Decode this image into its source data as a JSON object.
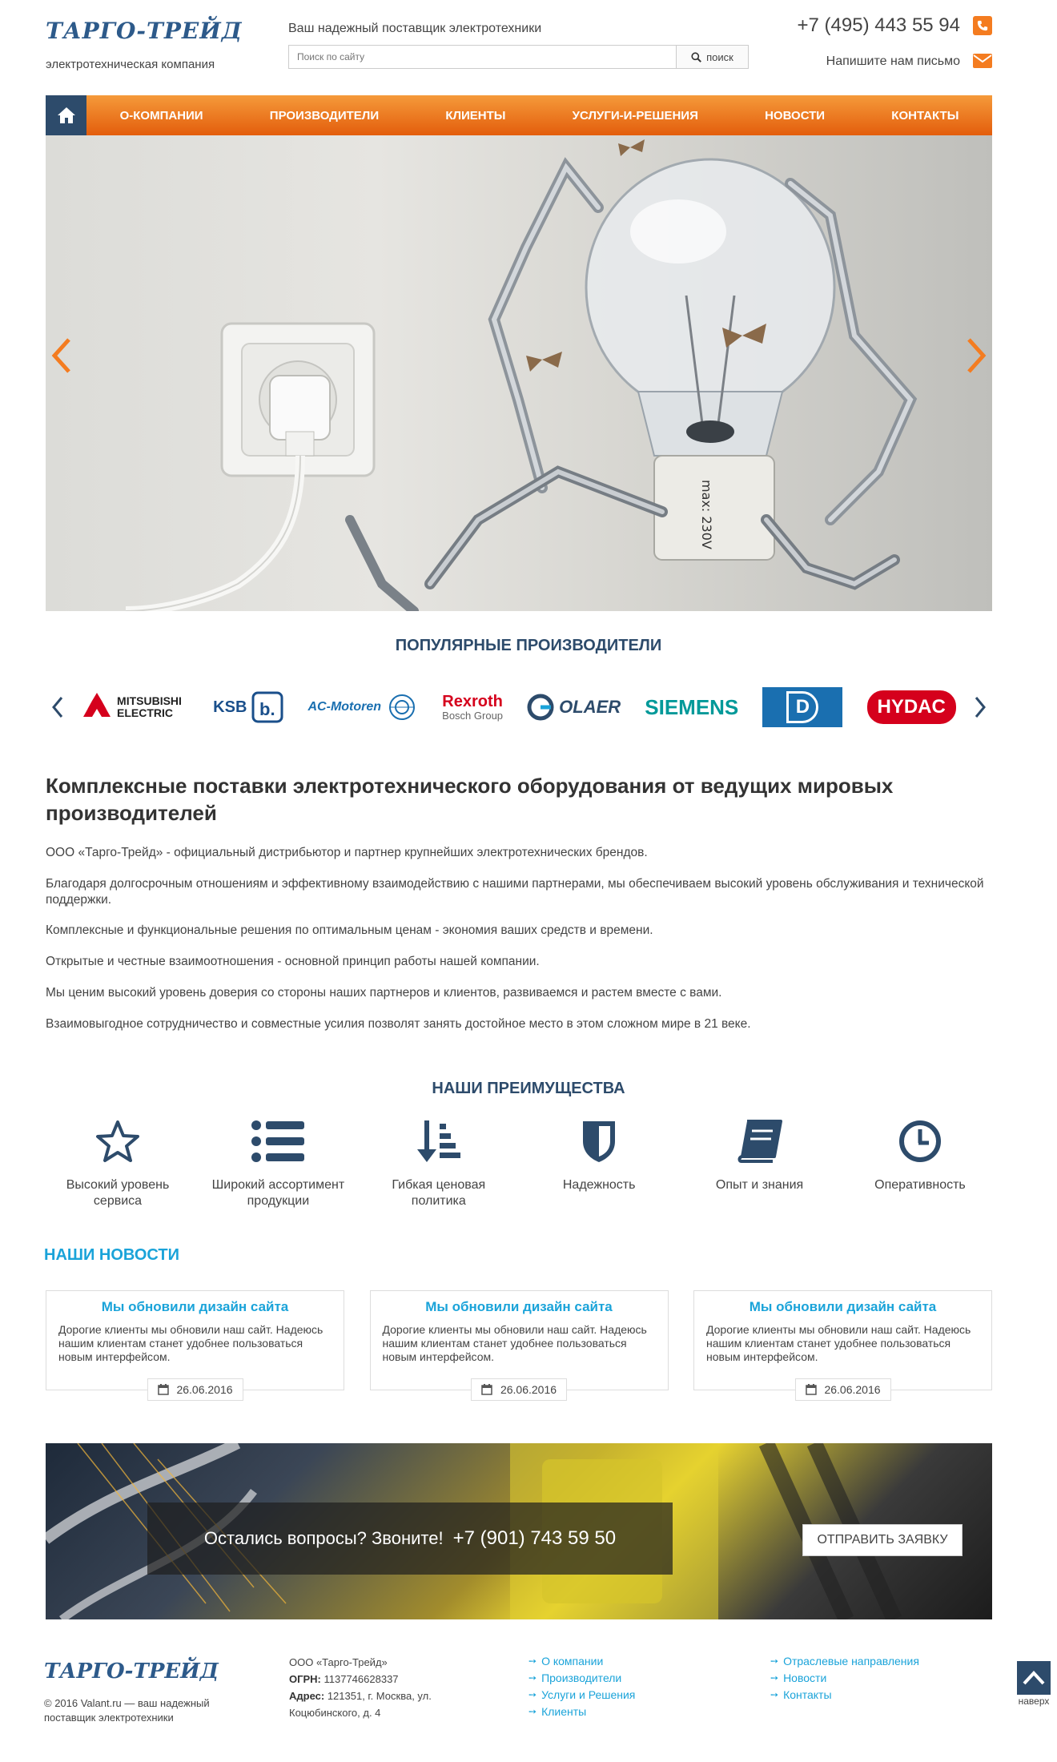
{
  "header": {
    "logo": "ТАРГО-ТРЕЙД",
    "logo_sub": "электротехническая компания",
    "tagline": "Ваш надежный поставщик электротехники",
    "search_placeholder": "Поиск по сайту",
    "search_button": "поиск",
    "phone": "+7 (495) 443 55 94",
    "write_us": "Напишите нам письмо"
  },
  "nav": {
    "items": [
      {
        "label": "О-КОМПАНИИ"
      },
      {
        "label": "ПРОИЗВОДИТЕЛИ"
      },
      {
        "label": "КЛИЕНТЫ"
      },
      {
        "label": "УСЛУГИ-И-РЕШЕНИЯ"
      },
      {
        "label": "НОВОСТИ"
      },
      {
        "label": "КОНТАКТЫ"
      }
    ]
  },
  "slider": {
    "label_text": "max: 230V"
  },
  "manufacturers": {
    "title": "ПОПУЛЯРНЫЕ ПРОИЗВОДИТЕЛИ",
    "brands": [
      {
        "name": "MITSUBISHI ELECTRIC",
        "color": "#222222"
      },
      {
        "name": "KSB",
        "color": "#1a4f8b"
      },
      {
        "name": "AC-Motoren",
        "color": "#1a6fb0"
      },
      {
        "name": "Rexroth",
        "sub": "Bosch Group",
        "color": "#d5001c"
      },
      {
        "name": "OLAER",
        "color": "#2d4b6b"
      },
      {
        "name": "SIEMENS",
        "color": "#009999"
      },
      {
        "name": "D",
        "color": "#1a6fb0"
      },
      {
        "name": "HYDAC",
        "color": "#d5001c"
      }
    ]
  },
  "about": {
    "title": "Комплексные поставки электротехнического оборудования от ведущих мировых производителей",
    "paragraphs": [
      "ООО «Тарго-Трейд» -  официальный дистрибьютор и партнер крупнейших электротехнических брендов.",
      "Благодаря долгосрочным отношениям и эффективному взаимодействию с нашими партнерами, мы обеспечиваем высокий уровень обслуживания и технической поддержки.",
      "Комплексные и функциональные решения по оптимальным ценам -  экономия ваших средств и времени.",
      "Открытые и честные взаимоотношения -  основной принцип работы нашей компании.",
      "Мы ценим высокий уровень доверия со стороны наших партнеров и клиентов, развиваемся и растем вместе с вами.",
      "Взаимовыгодное сотрудничество и совместные усилия позволят занять достойное место в этом сложном мире в 21 веке."
    ]
  },
  "advantages": {
    "title": "НАШИ ПРЕИМУЩЕСТВА",
    "items": [
      {
        "icon": "star-icon",
        "label": "Высокий уровень сервиса"
      },
      {
        "icon": "list-icon",
        "label": "Широкий ассортимент продукции"
      },
      {
        "icon": "sort-icon",
        "label": "Гибкая ценовая политика"
      },
      {
        "icon": "shield-icon",
        "label": "Надежность"
      },
      {
        "icon": "book-icon",
        "label": "Опыт и знания"
      },
      {
        "icon": "clock-icon",
        "label": "Оперативность"
      }
    ],
    "icon_color": "#2d4b6b"
  },
  "news": {
    "title": "НАШИ НОВОСТИ",
    "items": [
      {
        "title": "Мы обновили дизайн сайта",
        "text": "Дорогие клиенты мы обновили наш сайт. Надеюсь нашим клиентам станет удобнее пользоваться новым интерфейсом.",
        "date": "26.06.2016"
      },
      {
        "title": "Мы обновили дизайн сайта",
        "text": "Дорогие клиенты мы обновили наш сайт. Надеюсь нашим клиентам станет удобнее пользоваться новым интерфейсом.",
        "date": "26.06.2016"
      },
      {
        "title": "Мы обновили дизайн сайта",
        "text": "Дорогие клиенты мы обновили наш сайт. Надеюсь нашим клиентам станет удобнее пользоваться новым интерфейсом.",
        "date": "26.06.2016"
      }
    ]
  },
  "cta": {
    "text": "Остались вопросы? Звоните!",
    "phone": "+7 (901) 743 59 50",
    "button": "ОТПРАВИТЬ ЗАЯВКУ"
  },
  "footer": {
    "logo": "ТАРГО-ТРЕЙД",
    "copyright": "© 2016 Valant.ru — ваш надежный поставщик электротехники",
    "company_name": "ООО «Тарго-Трейд»",
    "ogrn_label": "ОГРН:",
    "ogrn": "1137746628337",
    "address_label": "Адрес:",
    "address": "121351, г. Москва, ул. Коцюбинского, д. 4",
    "links_col1": [
      "О компании",
      "Производители",
      "Услуги и Решения",
      "Клиенты"
    ],
    "links_col2": [
      "Отраслевые направления",
      "Новости",
      "Контакты"
    ],
    "to_top": "наверх"
  },
  "colors": {
    "brand_blue": "#2d5a8a",
    "accent_orange": "#f47c20",
    "news_blue": "#1aa3d9",
    "dark_navy": "#2d4b6b"
  }
}
